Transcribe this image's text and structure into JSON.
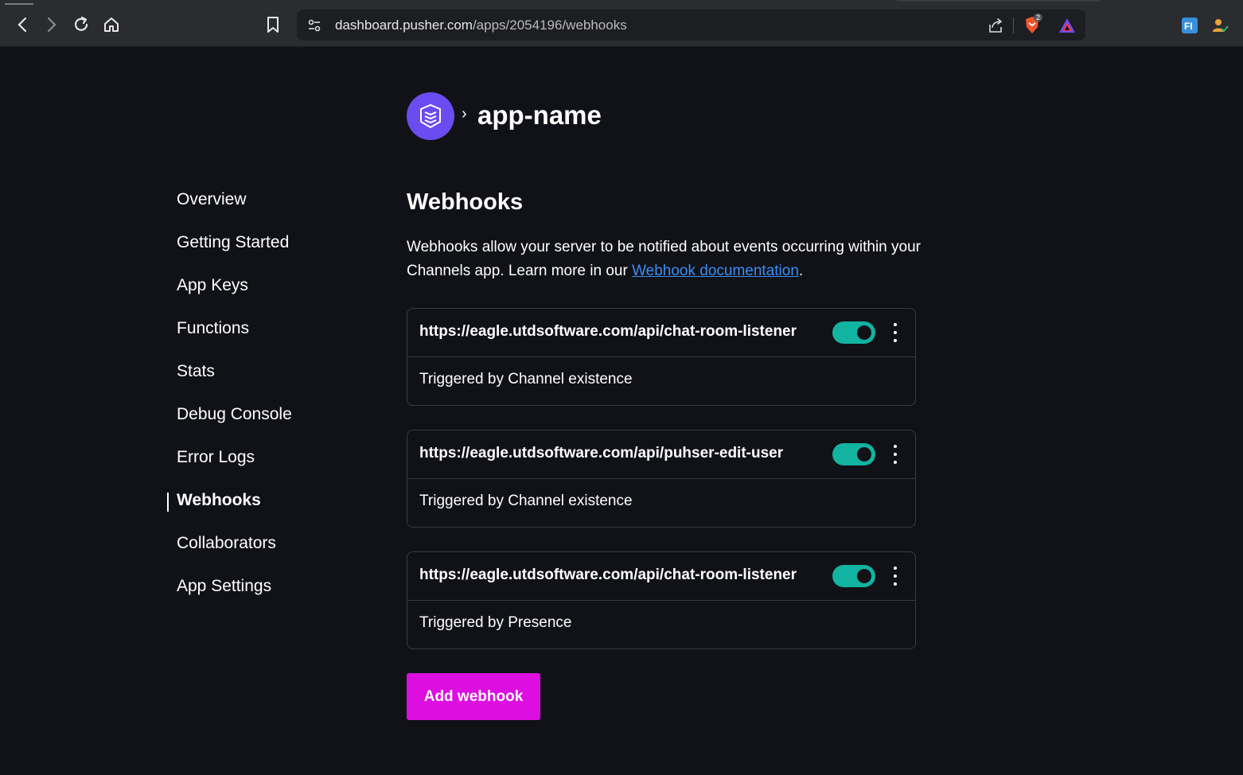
{
  "browser": {
    "url_host": "dashboard.pusher.com",
    "url_path": "/apps/2054196/webhooks",
    "brave_badge": "2"
  },
  "header": {
    "separator": "›",
    "app_name": "app-name"
  },
  "sidebar": {
    "items": [
      {
        "label": "Overview"
      },
      {
        "label": "Getting Started"
      },
      {
        "label": "App Keys"
      },
      {
        "label": "Functions"
      },
      {
        "label": "Stats"
      },
      {
        "label": "Debug Console"
      },
      {
        "label": "Error Logs"
      },
      {
        "label": "Webhooks",
        "active": true
      },
      {
        "label": "Collaborators"
      },
      {
        "label": "App Settings"
      }
    ]
  },
  "main": {
    "title": "Webhooks",
    "intro_text": "Webhooks allow your server to be notified about events occurring within your Channels app. Learn more in our ",
    "intro_link": "Webhook documentation",
    "intro_end": ".",
    "webhooks": [
      {
        "url": "https://eagle.utdsoftware.com/api/chat-room-listener",
        "trigger": "Triggered by Channel existence",
        "enabled": true
      },
      {
        "url": "https://eagle.utdsoftware.com/api/puhser-edit-user",
        "trigger": "Triggered by Channel existence",
        "enabled": true
      },
      {
        "url": "https://eagle.utdsoftware.com/api/chat-room-listener",
        "trigger": "Triggered by Presence",
        "enabled": true
      }
    ],
    "add_button": "Add webhook"
  },
  "colors": {
    "background": "#111217",
    "accent_magenta": "#dd0ee0",
    "toggle_on": "#12b3a0",
    "logo_purple": "#6b4cf0",
    "link": "#3b8ef5"
  }
}
